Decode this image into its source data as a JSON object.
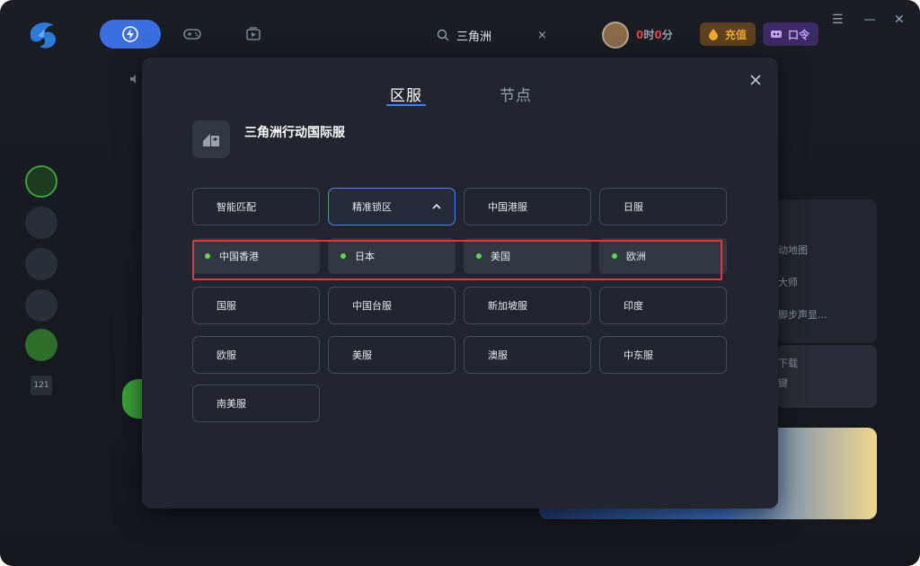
{
  "header": {
    "search_text": "三角洲",
    "search_clear": "×",
    "time_prefix": "0",
    "time_hours_unit": "时",
    "time_minutes": "0",
    "time_minutes_unit": "分",
    "recharge_label": "充值",
    "code_label": "口令",
    "min_glyph": "—",
    "menu_glyph": "☰",
    "close_glyph": "✕"
  },
  "background": {
    "texts": [
      "动地图",
      "大师",
      "脚步声显...",
      "下载",
      "键"
    ],
    "sidebar_badge": "121"
  },
  "modal": {
    "tabs": [
      {
        "label": "区服",
        "active": true
      },
      {
        "label": "节点",
        "active": false
      }
    ],
    "game_title": "三角洲行动国际服",
    "options_row1": [
      "智能匹配",
      "精准锁区",
      "中国港服",
      "日服"
    ],
    "selected_option": "精准锁区",
    "sub_regions": [
      "中国香港",
      "日本",
      "美国",
      "欧洲"
    ],
    "options_row3": [
      "国服",
      "中国台服",
      "新加坡服",
      "印度"
    ],
    "options_row4": [
      "欧服",
      "美服",
      "澳服",
      "中东服"
    ],
    "options_row5": [
      "南美服"
    ]
  },
  "colors": {
    "accent": "#3b82f6",
    "online_dot": "#5fd35a",
    "highlight_box": "#e0393e",
    "recharge": "#f0a92e",
    "code": "#c6a3ff"
  }
}
